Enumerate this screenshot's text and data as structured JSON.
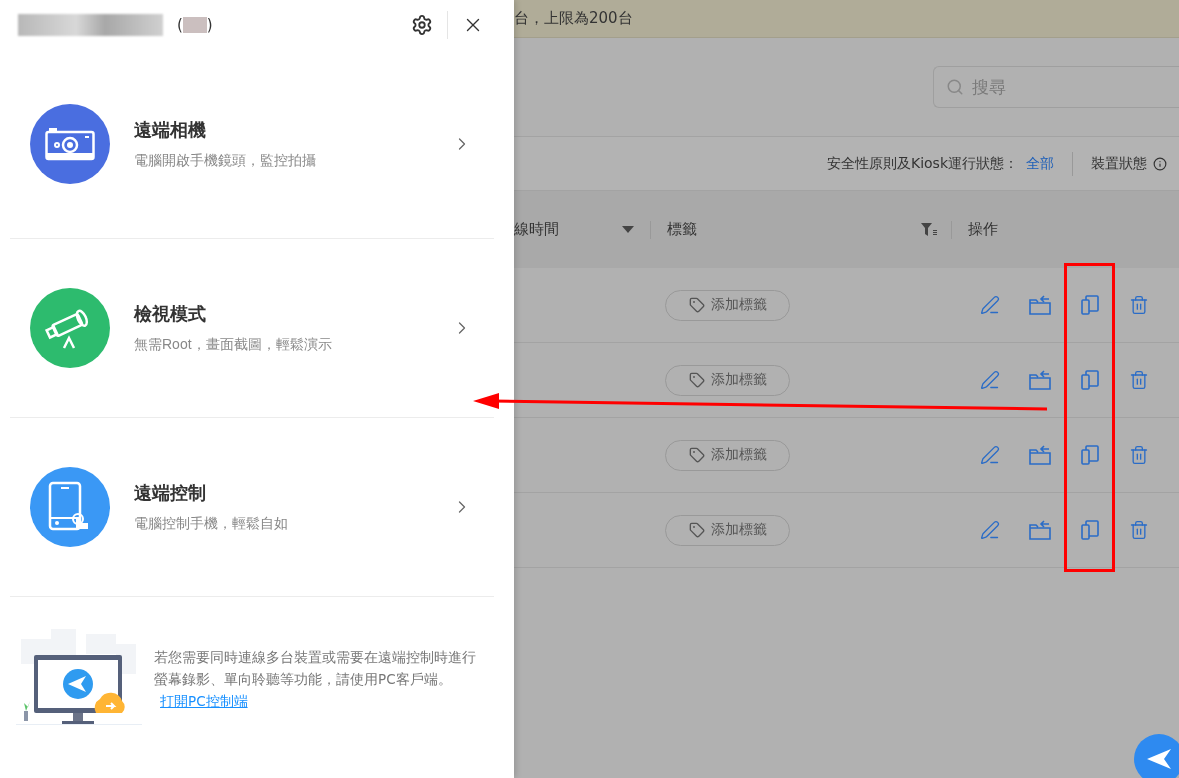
{
  "panel": {
    "header": {
      "title_open": "(",
      "title_close": ")"
    },
    "features": [
      {
        "kind": "camera",
        "title": "遠端相機",
        "subtitle": "電腦開啟手機鏡頭，監控拍攝",
        "color": "#4a6ee0"
      },
      {
        "kind": "telescope",
        "title": "檢視模式",
        "subtitle": "無需Root，畫面截圖，輕鬆演示",
        "color": "#2dbb6e"
      },
      {
        "kind": "phone",
        "title": "遠端控制",
        "subtitle": "電腦控制手機，輕鬆自如",
        "color": "#3a98f5"
      }
    ],
    "footer": {
      "text": "若您需要同時連線多台裝置或需要在遠端控制時進行螢幕錄影、單向聆聽等功能，請使用PC客戶端。",
      "link": "打開PC控制端"
    }
  },
  "background": {
    "banner": "台，上限為200台",
    "search": {
      "placeholder": "搜尋"
    },
    "filters": [
      {
        "label": "安全性原則及Kiosk運行狀態：",
        "value": "全部"
      },
      {
        "label": "裝置狀態"
      }
    ],
    "columns": [
      {
        "label": "線時間",
        "kind": "sort"
      },
      {
        "label": "標籤",
        "kind": "filter"
      },
      {
        "label": "操作",
        "kind": "plain"
      }
    ],
    "rows": [
      {
        "tag": "添加標籤"
      },
      {
        "tag": "添加標籤"
      },
      {
        "tag": "添加標籤"
      },
      {
        "tag": "添加標籤"
      }
    ]
  }
}
